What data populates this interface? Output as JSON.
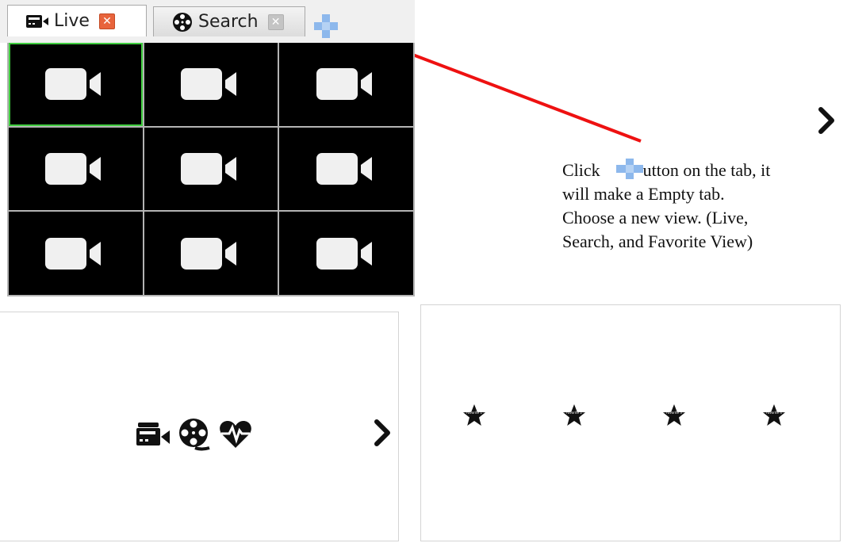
{
  "tabs": [
    {
      "label": "Live",
      "icon": "camcorder-icon",
      "close_icon": "close-icon",
      "active": true
    },
    {
      "label": "Search",
      "icon": "film-reel-icon",
      "close_icon": "close-icon",
      "active": false
    }
  ],
  "add_tab": {
    "icon": "plus-icon",
    "color": "#8db8ec"
  },
  "grid": {
    "rows": 3,
    "cols": 3,
    "selected_index": 0,
    "cell_icon": "video-camera-icon",
    "selected_color": "#3fcd3f"
  },
  "annotation": {
    "line1_before": "Click",
    "line1_after": "utton on the tab, it",
    "line2": "will make a Empty tab.",
    "line3": "Choose a new view. (Live,",
    "line4": "Search, and Favorite View)",
    "arrow_color": "#ee1111"
  },
  "view_panel": {
    "icons": [
      "camcorder-icon",
      "film-reel-icon",
      "heart-pulse-icon"
    ],
    "next_icon": "chevron-right-icon"
  },
  "favorites_panel": {
    "items": [
      {
        "label": "Favorite 1",
        "icon": "star-icon"
      },
      {
        "label": "Favorite 2",
        "icon": "star-icon"
      },
      {
        "label": "Favorite 3",
        "icon": "star-icon"
      },
      {
        "label": "Favorite 4",
        "icon": "star-icon"
      }
    ],
    "next_icon": "chevron-right-icon"
  }
}
